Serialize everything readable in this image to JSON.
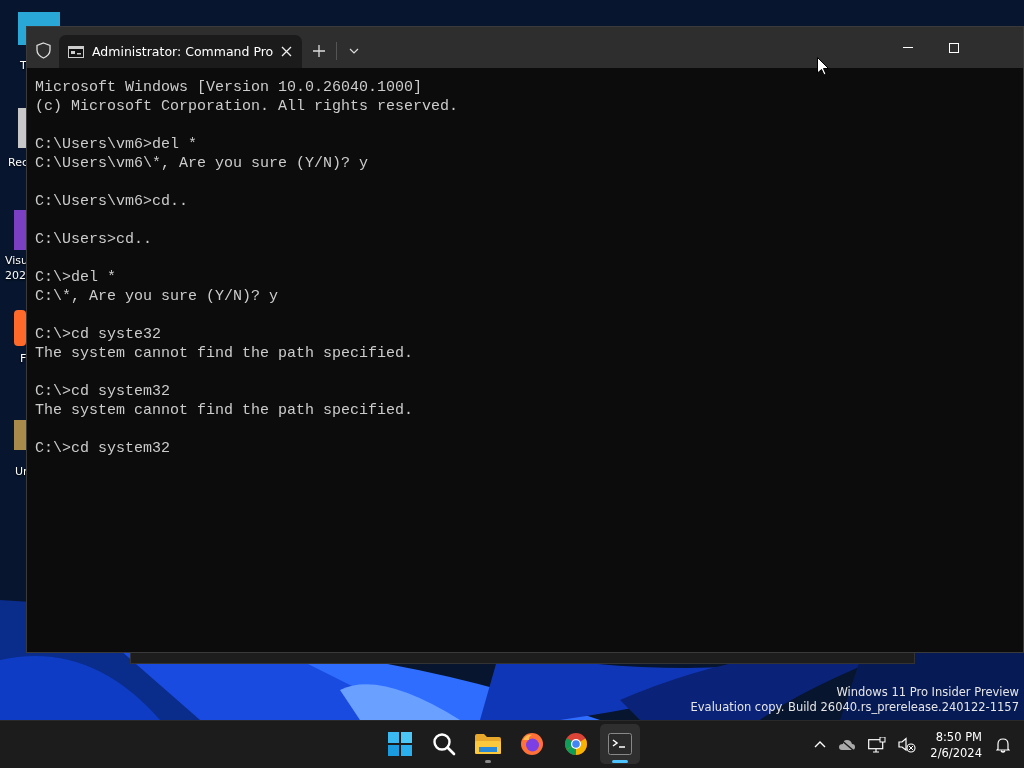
{
  "desktop_icons": [
    {
      "label": "T"
    },
    {
      "label": "Rec"
    },
    {
      "label": "Visu 202"
    },
    {
      "label": "F"
    },
    {
      "label": "Ur"
    }
  ],
  "window": {
    "tabs": [
      {
        "title": "Administrator: Command Pro",
        "selected": true
      }
    ],
    "console": [
      [
        "Microsoft Windows [Version 10.0.26040.1000]",
        "(c) Microsoft Corporation. All rights reserved."
      ],
      [
        "C:\\Users\\vm6>del *",
        "C:\\Users\\vm6\\*, Are you sure (Y/N)? y"
      ],
      [
        "C:\\Users\\vm6>cd.."
      ],
      [
        "C:\\Users>cd.."
      ],
      [
        "C:\\>del *",
        "C:\\*, Are you sure (Y/N)? y"
      ],
      [
        "C:\\>cd syste32",
        "The system cannot find the path specified."
      ],
      [
        "C:\\>cd system32",
        "The system cannot find the path specified."
      ],
      [
        "C:\\>cd system32"
      ]
    ]
  },
  "evaluation_notice": [
    "Windows 11 Pro Insider Preview",
    "Evaluation copy. Build 26040.rs_prerelease.240122-1157"
  ],
  "taskbar": {
    "apps": [
      {
        "kind": "start",
        "running": false,
        "selected": false
      },
      {
        "kind": "search",
        "running": false,
        "selected": false
      },
      {
        "kind": "explorer",
        "running": true,
        "selected": false
      },
      {
        "kind": "firefox",
        "running": false,
        "selected": false
      },
      {
        "kind": "chrome",
        "running": false,
        "selected": false
      },
      {
        "kind": "terminal",
        "running": true,
        "selected": true
      }
    ],
    "tray": {
      "time": "8:50 PM",
      "date": "2/6/2024"
    }
  }
}
